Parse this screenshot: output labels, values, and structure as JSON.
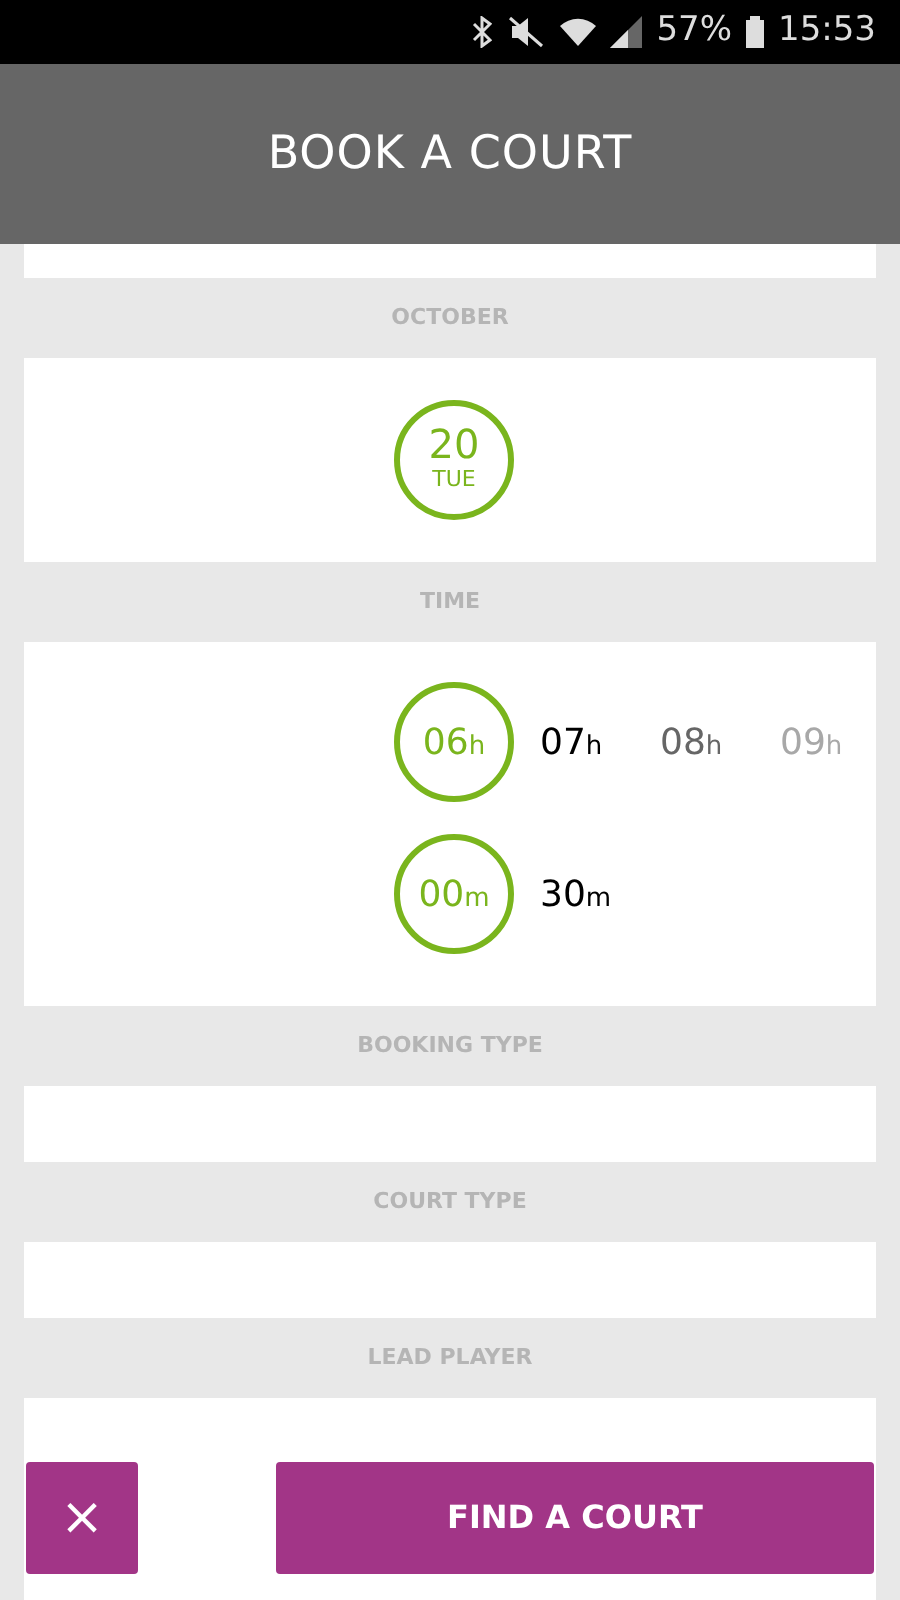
{
  "status_bar": {
    "battery": "57%",
    "time": "15:53"
  },
  "header": {
    "title": "BOOK A COURT"
  },
  "sections": [
    {
      "label": "OCTOBER",
      "kind": "dates",
      "dates": [
        {
          "day": "20",
          "weekday": "TUE",
          "selected": true
        }
      ]
    },
    {
      "label": "TIME",
      "kind": "time",
      "hours": [
        {
          "value": "06",
          "unit": "h",
          "selected": true,
          "color": "#7ab51d"
        },
        {
          "value": "07",
          "unit": "h",
          "selected": false,
          "color": "#000000"
        },
        {
          "value": "08",
          "unit": "h",
          "selected": false,
          "color": "#666666"
        },
        {
          "value": "09",
          "unit": "h",
          "selected": false,
          "color": "#a8a8a8"
        }
      ],
      "minutes": [
        {
          "value": "00",
          "unit": "m",
          "selected": true,
          "color": "#7ab51d"
        },
        {
          "value": "30",
          "unit": "m",
          "selected": false,
          "color": "#000000"
        }
      ]
    },
    {
      "label": "BOOKING TYPE",
      "kind": "empty"
    },
    {
      "label": "COURT TYPE",
      "kind": "empty"
    },
    {
      "label": "LEAD PLAYER",
      "kind": "empty"
    }
  ],
  "actions": {
    "cancel": "×",
    "submit": "FIND A COURT"
  }
}
